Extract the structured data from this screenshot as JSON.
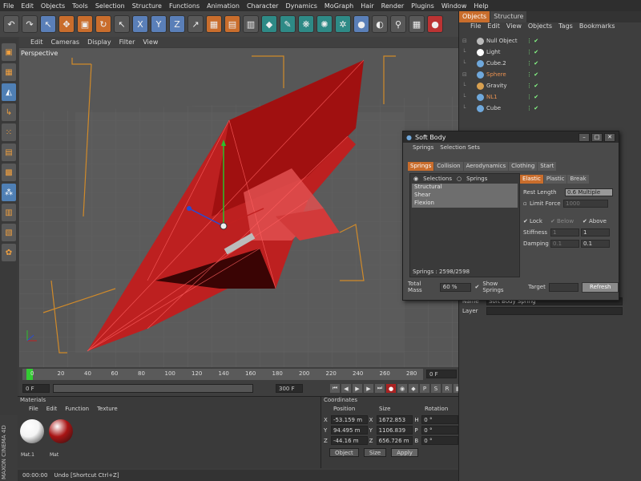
{
  "menubar": [
    "File",
    "Edit",
    "Objects",
    "Tools",
    "Selection",
    "Structure",
    "Functions",
    "Animation",
    "Character",
    "Dynamics",
    "MoGraph",
    "Hair",
    "Render",
    "Plugins",
    "Window",
    "Help"
  ],
  "viewport": {
    "menu": [
      "Edit",
      "Cameras",
      "Display",
      "Filter",
      "View"
    ],
    "label": "Perspective"
  },
  "timeline": {
    "ticks": [
      "0",
      "20",
      "40",
      "60",
      "80",
      "100",
      "120",
      "140",
      "160",
      "180",
      "200",
      "220",
      "240",
      "260",
      "280"
    ],
    "frame_end": "0 F",
    "current_frame": "0 F",
    "start_field": "0 F",
    "end_field": "300 F"
  },
  "materials": {
    "title": "Materials",
    "menu": [
      "File",
      "Edit",
      "Function",
      "Texture"
    ],
    "items": [
      {
        "label": "Mat.1",
        "color": "#f4f4f4"
      },
      {
        "label": "Mat",
        "color": "#a81414"
      }
    ]
  },
  "coordinates": {
    "title": "Coordinates",
    "headers": [
      "Position",
      "Size",
      "Rotation"
    ],
    "rows": [
      {
        "axis": "X",
        "pos": "-53.159 m",
        "size_axis": "X",
        "size": "1672.853 m",
        "rot_axis": "H",
        "rot": "0 °"
      },
      {
        "axis": "Y",
        "pos": "94.495 m",
        "size_axis": "Y",
        "size": "1106.839 m",
        "rot_axis": "P",
        "rot": "0 °"
      },
      {
        "axis": "Z",
        "pos": "-44.16 m",
        "size_axis": "Z",
        "size": "656.726 m",
        "rot_axis": "B",
        "rot": "0 °"
      }
    ],
    "mode_select": "Object",
    "size_select": "Size",
    "apply_label": "Apply"
  },
  "statusbar": {
    "time": "00:00:00",
    "message": "Undo [Shortcut Ctrl+Z]"
  },
  "brand": "MAXON CINEMA 4D",
  "objects_panel": {
    "tabs": [
      "Objects",
      "Structure"
    ],
    "menu": [
      "File",
      "Edit",
      "View",
      "Objects",
      "Tags",
      "Bookmarks"
    ],
    "items": [
      {
        "name": "Null Object",
        "indent": 0,
        "icon_color": "#bbbbbb",
        "highlight": false
      },
      {
        "name": "Light",
        "indent": 1,
        "icon_color": "#ffffff",
        "highlight": false
      },
      {
        "name": "Cube.2",
        "indent": 1,
        "icon_color": "#6fa8dc",
        "highlight": false
      },
      {
        "name": "Sphere",
        "indent": 0,
        "icon_color": "#6fa8dc",
        "highlight": true
      },
      {
        "name": "Gravity",
        "indent": 1,
        "icon_color": "#d8a050",
        "highlight": false
      },
      {
        "name": "NL1",
        "indent": 1,
        "icon_color": "#6fa8dc",
        "highlight": true
      },
      {
        "name": "Cube",
        "indent": 1,
        "icon_color": "#6fa8dc",
        "highlight": false
      }
    ]
  },
  "attributes": {
    "name_label": "Name",
    "name_value": "Soft Body Spring",
    "layer_label": "Layer"
  },
  "soft_body_dialog": {
    "title": "Soft Body",
    "menu": [
      "Springs",
      "Selection Sets"
    ],
    "tabs": [
      "Springs",
      "Collision",
      "Aerodynamics",
      "Clothing",
      "Start"
    ],
    "radio_selections": "Selections",
    "radio_springs": "Springs",
    "list": [
      "Structural",
      "Shear",
      "Flexion"
    ],
    "springs_count": "Springs : 2598/2598",
    "sub_tabs": [
      "Elastic",
      "Plastic",
      "Break"
    ],
    "rest_length_label": "Rest Length",
    "rest_length_value": "0.6 Multiple",
    "limit_force_label": "Limit Force",
    "limit_force_value": "1000",
    "lock_label": "Lock",
    "below_label": "Below",
    "above_label": "Above",
    "stiffness_label": "Stiffness",
    "stiffness_below": "1",
    "stiffness_above": "1",
    "damping_label": "Damping",
    "damping_below": "0.1",
    "damping_above": "0.1",
    "total_mass_label": "Total Mass",
    "total_mass_value": "60 %",
    "show_springs_label": "Show Springs",
    "target_label": "Target",
    "refresh_label": "Refresh"
  }
}
